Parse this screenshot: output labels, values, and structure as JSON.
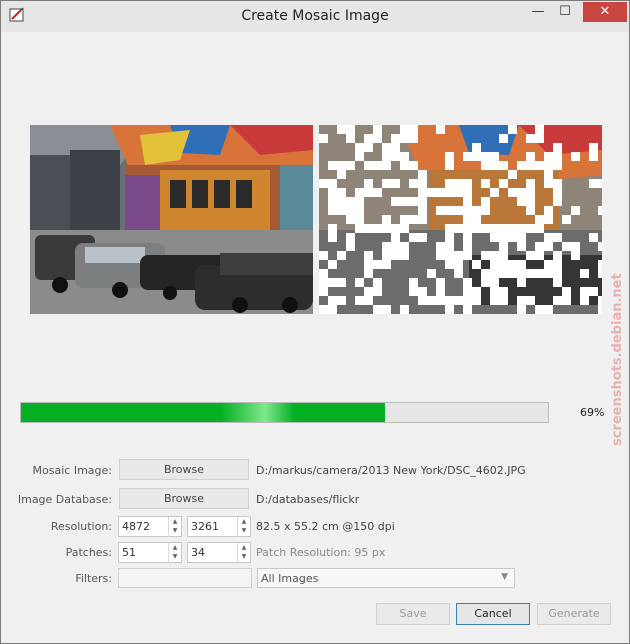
{
  "window": {
    "title": "Create Mosaic Image",
    "min_symbol": "—",
    "max_symbol": "☐",
    "close_symbol": "✕"
  },
  "progress": {
    "value": 0.69,
    "label": "69%"
  },
  "form": {
    "mosaic_image": {
      "label": "Mosaic Image:",
      "button": "Browse",
      "path": "D:/markus/camera/2013 New York/DSC_4602.JPG"
    },
    "image_database": {
      "label": "Image Database:",
      "button": "Browse",
      "path": "D:/databases/flickr"
    },
    "resolution": {
      "label": "Resolution:",
      "width": "4872",
      "height": "3261",
      "info": "82.5 x 55.2 cm @150 dpi"
    },
    "patches": {
      "label": "Patches:",
      "x": "51",
      "y": "34",
      "info": "Patch Resolution: 95 px"
    },
    "filters": {
      "label": "Filters:",
      "value": "",
      "select": "All Images"
    }
  },
  "buttons": {
    "save": "Save",
    "cancel": "Cancel",
    "generate": "Generate"
  },
  "watermark": "screenshots.debian.net",
  "icons": {
    "app": "app-icon",
    "spin": "spin-arrows-icon",
    "dropdown": "chevron-down-icon"
  }
}
